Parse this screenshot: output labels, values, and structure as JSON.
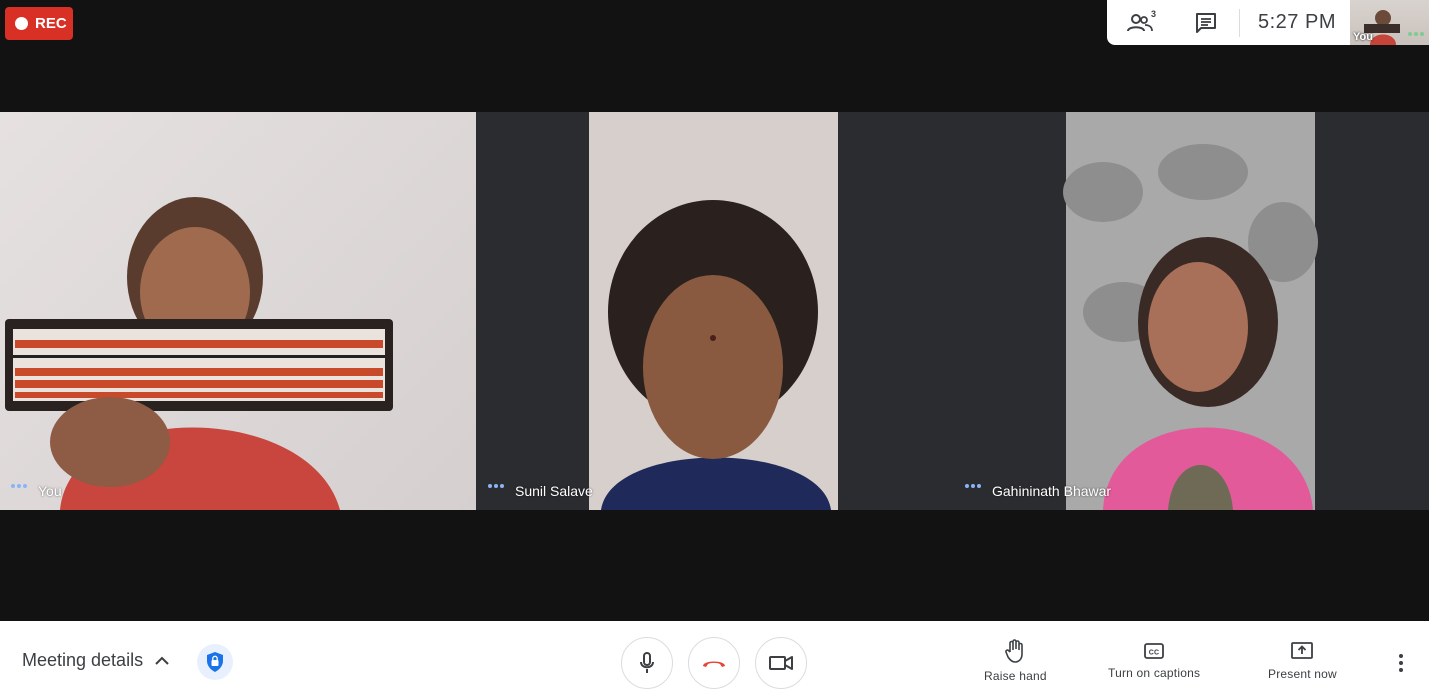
{
  "recording": {
    "label": "REC"
  },
  "top_panel": {
    "participants_count": "3",
    "clock": "5:27  PM",
    "self_thumbnail_label": "You"
  },
  "tiles": [
    {
      "name": "You"
    },
    {
      "name": "Sunil Salave"
    },
    {
      "name": "Gahininath Bhawar"
    }
  ],
  "bottom_bar": {
    "meeting_details_label": "Meeting details",
    "raise_hand_label": "Raise hand",
    "captions_label": "Turn on captions",
    "present_label": "Present now"
  },
  "colors": {
    "rec_red": "#d93025",
    "hangup_red": "#ea4335",
    "speaking_dots": "#81c995",
    "shield_blue": "#1a73e8"
  },
  "icons": [
    "participants-icon",
    "chat-icon",
    "chevron-up-icon",
    "shield-lock-icon",
    "mic-icon",
    "hangup-icon",
    "camera-icon",
    "raise-hand-icon",
    "captions-icon",
    "present-icon",
    "more-vert-icon"
  ]
}
